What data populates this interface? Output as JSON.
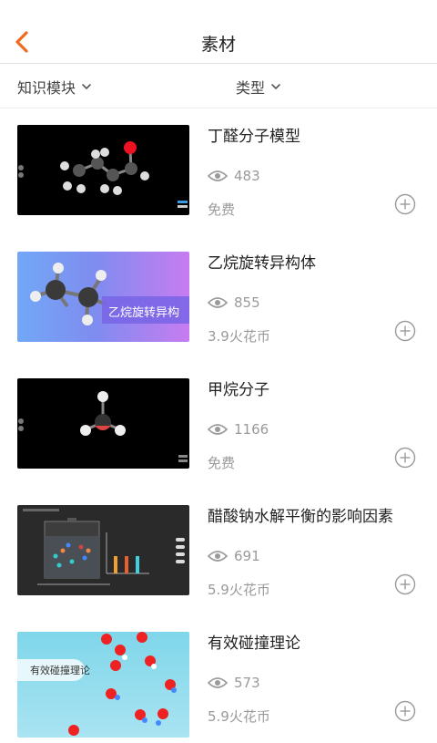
{
  "header": {
    "title": "素材",
    "back_icon": "chevron-left-icon",
    "accent": "#ee6a1f"
  },
  "filters": [
    {
      "label": "知识模块",
      "icon": "chevron-down-icon"
    },
    {
      "label": "类型",
      "icon": "chevron-down-icon"
    }
  ],
  "items": [
    {
      "title": "丁醛分子模型",
      "views": "483",
      "price": "免费",
      "thumb_label": ""
    },
    {
      "title": "乙烷旋转异构体",
      "views": "855",
      "price": "3.9火花币",
      "thumb_label": "乙烷旋转异构"
    },
    {
      "title": "甲烷分子",
      "views": "1166",
      "price": "免费",
      "thumb_label": ""
    },
    {
      "title": "醋酸钠水解平衡的影响因素",
      "views": "691",
      "price": "5.9火花币",
      "thumb_label": ""
    },
    {
      "title": "有效碰撞理论",
      "views": "573",
      "price": "5.9火花币",
      "thumb_label": "有效碰撞理论"
    }
  ],
  "colors": {
    "muted": "#9a9a9a",
    "divider": "#e2e2e2"
  }
}
